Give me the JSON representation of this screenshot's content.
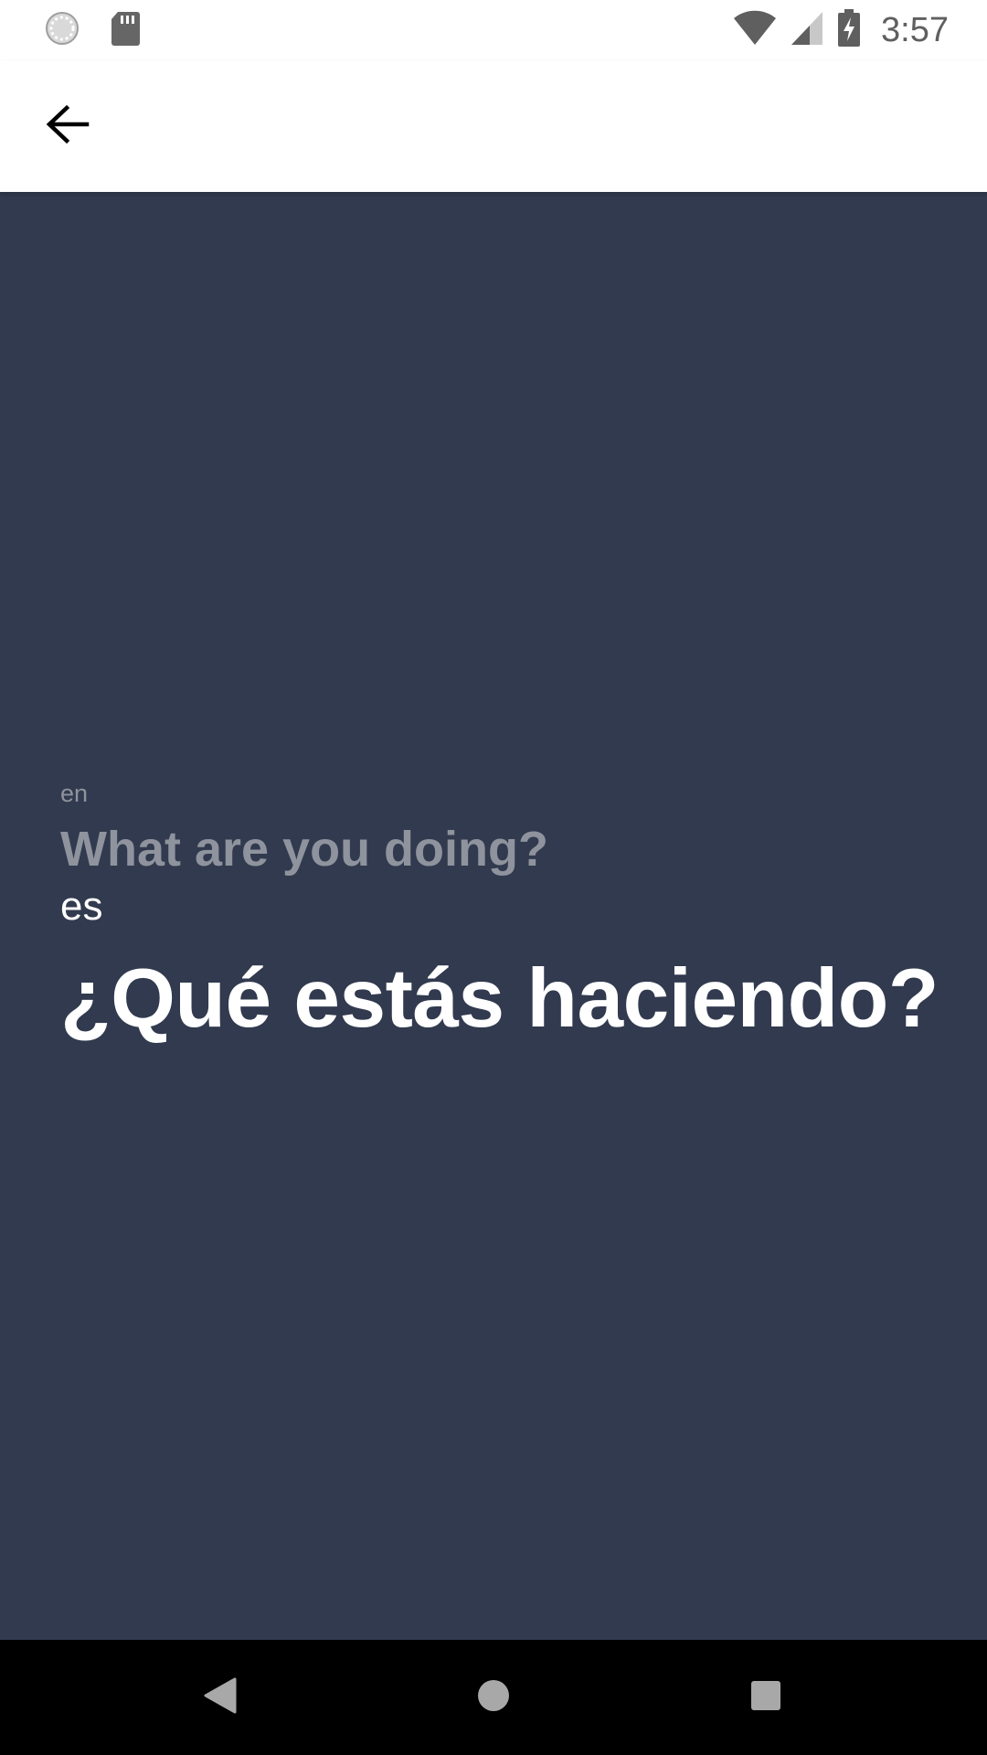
{
  "status_bar": {
    "time": "3:57",
    "icons": [
      "sync-icon",
      "sd-card-icon",
      "wifi-icon",
      "cell-signal-icon",
      "battery-charging-icon"
    ]
  },
  "app_bar": {
    "back_icon": "arrow-left-icon"
  },
  "translation": {
    "source_language": "en",
    "source_text": "What are you doing?",
    "target_language": "es",
    "target_text": "¿Qué estás haciendo?"
  },
  "nav_bar": {
    "icons": [
      "nav-back-icon",
      "nav-home-icon",
      "nav-recents-icon"
    ]
  },
  "colors": {
    "content_background": "#313a4e",
    "source_text": "#8e939d",
    "target_text": "#ffffff",
    "status_icons": "#5f5f5f"
  }
}
